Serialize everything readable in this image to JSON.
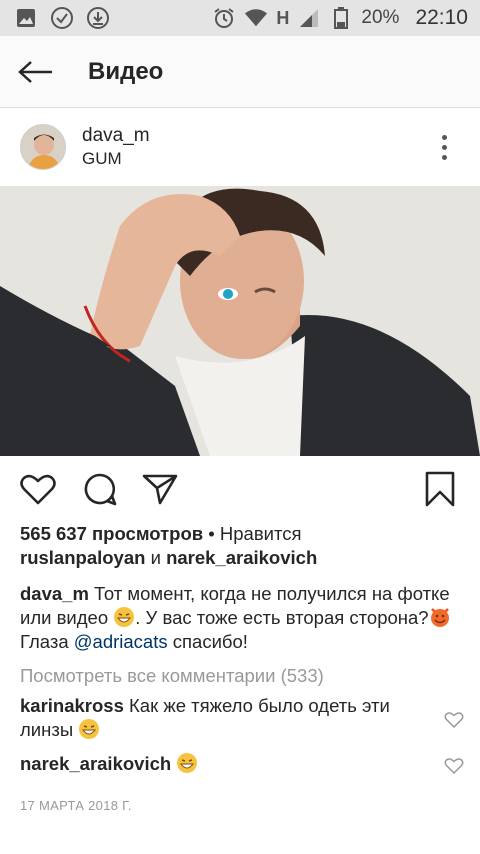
{
  "status_bar": {
    "network": "H",
    "battery": "20%",
    "time": "22:10"
  },
  "app_bar": {
    "title": "Видео"
  },
  "post": {
    "username": "dava_m",
    "location": "GUM",
    "views": "565 637 просмотров",
    "liked_by_prefix": " • Нравится",
    "liked_user_1": "ruslanpaloyan",
    "liked_and": " и ",
    "liked_user_2": "narek_araikovich",
    "caption_user": "dava_m",
    "caption_text_1": " Тот момент, когда не получился на фотке или видео ",
    "caption_text_2": ". У вас тоже есть вторая сторона?",
    "caption_line2_prefix": "Глаза ",
    "caption_mention": "@adriacats",
    "caption_line2_suffix": " спасибо!",
    "view_all_comments": "Посмотреть все комментарии (533)",
    "comments": [
      {
        "user": "karinakross",
        "text": " Как же тяжело было одеть эти линзы "
      },
      {
        "user": "narek_araikovich",
        "text": " "
      }
    ],
    "date": "17 МАРТА 2018 Г."
  }
}
